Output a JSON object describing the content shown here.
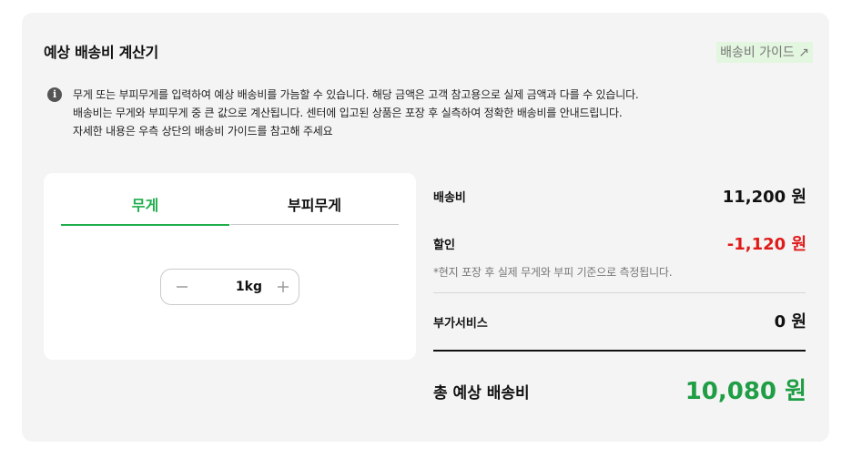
{
  "header": {
    "title": "예상 배송비 계산기",
    "guide_link": "배송비 가이드 ↗"
  },
  "info": {
    "icon": "info-icon",
    "lines": [
      "무게 또는 부피무게를 입력하여 예상 배송비를 가늠할 수 있습니다. 해당 금액은 고객 참고용으로 실제 금액과 다를 수 있습니다.",
      "배송비는 무게와 부피무게 중 큰 값으로 계산됩니다. 센터에 입고된 상품은 포장 후 실측하여 정확한 배송비를 안내드립니다.",
      "자세한 내용은 우측 상단의 배송비 가이드를 참고해 주세요"
    ]
  },
  "tabs": [
    {
      "label": "무게",
      "active": true
    },
    {
      "label": "부피무게",
      "active": false
    }
  ],
  "stepper": {
    "value": "1kg",
    "minus_icon": "minus-icon",
    "plus_icon": "plus-icon"
  },
  "summary": {
    "shipping_label": "배송비",
    "shipping_value": "11,200 원",
    "discount_label": "할인",
    "discount_value": "-1,120 원",
    "note": "*현지 포장 후 실제 무게와 부피 기준으로 측정됩니다.",
    "addon_label": "부가서비스",
    "addon_value": "0 원",
    "total_label": "총 예상 배송비",
    "total_value": "10,080 원"
  },
  "colors": {
    "accent_green": "#1fae4b",
    "total_green": "#1f9e45",
    "discount_red": "#e11a1a",
    "card_bg": "#f4f4f4"
  }
}
